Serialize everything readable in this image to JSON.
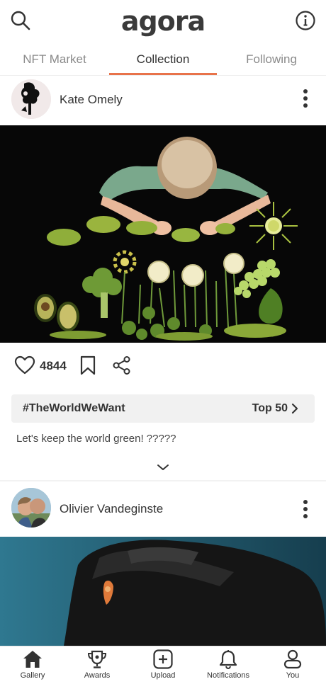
{
  "app": {
    "title": "agora"
  },
  "tabs": [
    {
      "label": "NFT Market"
    },
    {
      "label": "Collection"
    },
    {
      "label": "Following"
    }
  ],
  "posts": [
    {
      "author": "Kate Omely",
      "likes": "4844",
      "hashtag": "#TheWorldWeWant",
      "rank": "Top 50",
      "caption": "Let's keep the world green! ?????"
    },
    {
      "author": "Olivier Vandeginste"
    }
  ],
  "nav": [
    {
      "label": "Gallery",
      "icon": "home-icon"
    },
    {
      "label": "Awards",
      "icon": "trophy-icon"
    },
    {
      "label": "Upload",
      "icon": "plus-square-icon"
    },
    {
      "label": "Notifications",
      "icon": "bell-icon"
    },
    {
      "label": "You",
      "icon": "person-icon"
    }
  ],
  "colors": {
    "accent": "#e8734a",
    "text": "#333333",
    "muted": "#8a8a8a"
  }
}
